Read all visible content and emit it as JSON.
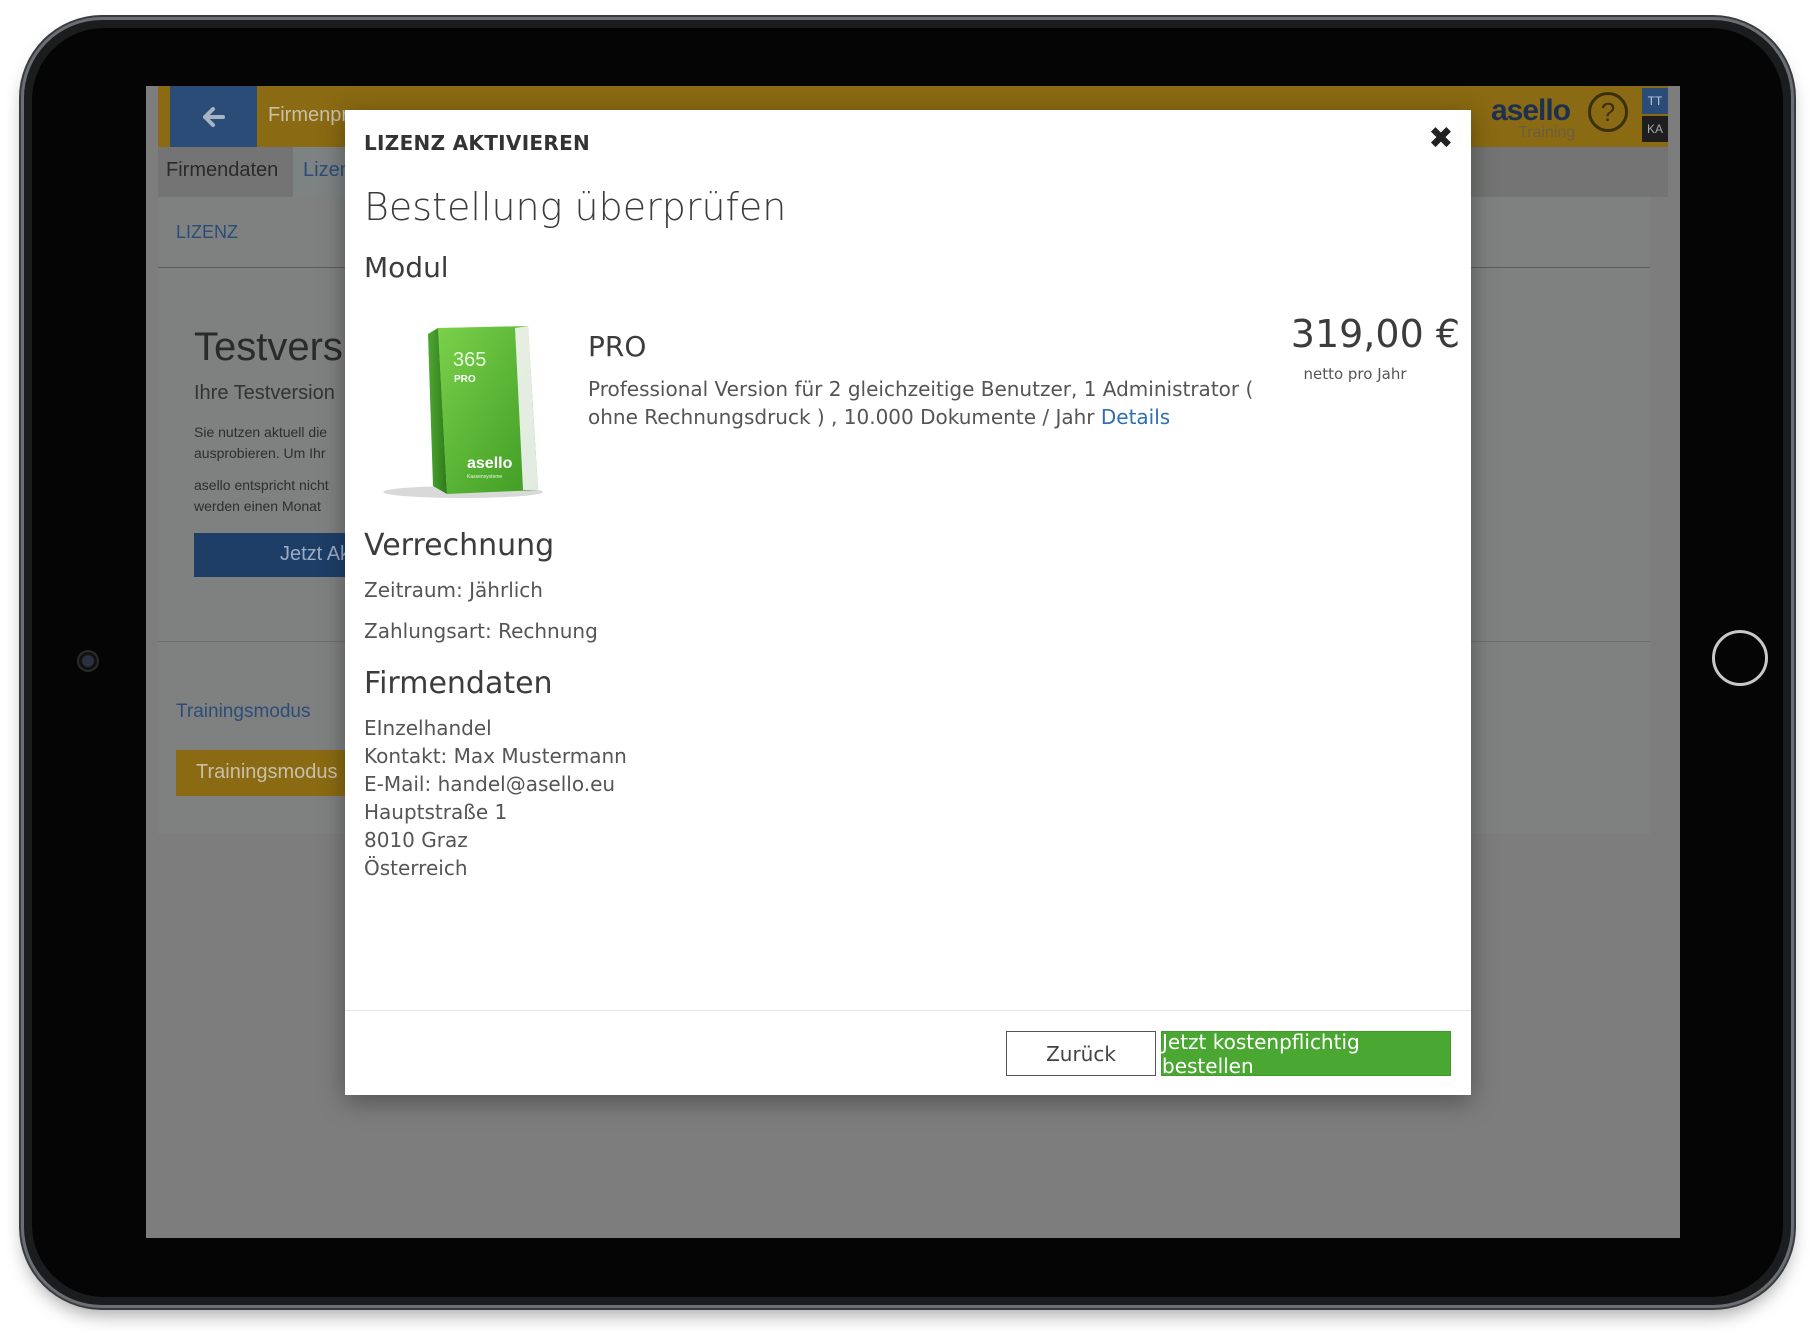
{
  "app": {
    "header_title": "Firmenpr",
    "brand": "asello",
    "brand_sub": "Training",
    "help_symbol": "?",
    "user_initials_top": "TT",
    "user_initials_bottom": "KA",
    "tabs": [
      {
        "label": "Firmendaten"
      },
      {
        "label": "Lizen"
      }
    ],
    "panel": {
      "section_label": "LIZENZ",
      "trial_title": "Testvers",
      "trial_subtitle": "Ihre Testversion",
      "trial_text_1": "Sie nutzen aktuell die ausprobieren. Um Ihr",
      "trial_text_2": "asello entspricht nicht werden einen Monat",
      "activate_button": "Jetzt Ak",
      "training_link": "Trainingsmodus",
      "training_button": "Trainingsmodus"
    }
  },
  "modal": {
    "header_title": "LIZENZ AKTIVIEREN",
    "close_symbol": "✖",
    "title": "Bestellung überprüfen",
    "modul_heading": "Modul",
    "product": {
      "box_label_365": "365",
      "box_label_pro": "PRO",
      "box_brand": "asello",
      "box_brand_sub": "Kassensysteme",
      "name": "PRO",
      "description": "Professional Version für 2 gleichzeitige Benutzer, 1 Administrator ( ohne Rechnungsdruck ) , 10.000 Dokumente / Jahr",
      "details_link": "Details",
      "price": "319,00 €",
      "price_note": "netto pro Jahr"
    },
    "billing": {
      "heading": "Verrechnung",
      "period": "Zeitraum: Jährlich",
      "payment": "Zahlungsart: Rechnung"
    },
    "company": {
      "heading": "Firmendaten",
      "name": "EInzelhandel",
      "contact": "Kontakt: Max Mustermann",
      "email": "E-Mail: handel@asello.eu",
      "street": "Hauptstraße 1",
      "city": "8010 Graz",
      "country": "Österreich"
    },
    "buttons": {
      "back": "Zurück",
      "order": "Jetzt kostenpflichtig bestellen"
    }
  },
  "colors": {
    "header_accent": "#e0a000",
    "primary_blue": "#2d6fb0",
    "order_green": "#4aa832"
  }
}
